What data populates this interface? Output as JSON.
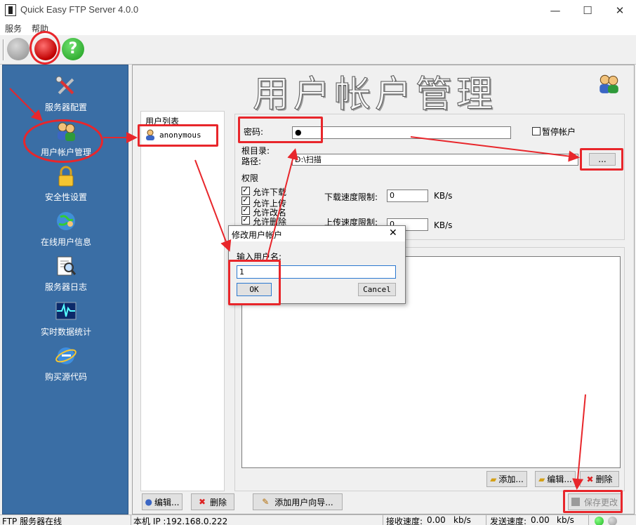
{
  "window": {
    "title": "Quick Easy FTP Server 4.0.0",
    "minimize": "—",
    "maximize": "☐",
    "close": "✕"
  },
  "menu": {
    "items": [
      "服务",
      "帮助"
    ]
  },
  "sidebar": {
    "items": [
      {
        "label": "服务器配置",
        "icon": "tools-icon"
      },
      {
        "label": "用户帐户管理",
        "icon": "users-icon"
      },
      {
        "label": "安全性设置",
        "icon": "lock-icon"
      },
      {
        "label": "在线用户信息",
        "icon": "globe-users-icon"
      },
      {
        "label": "服务器日志",
        "icon": "log-search-icon"
      },
      {
        "label": "实时数据统计",
        "icon": "pulse-chart-icon"
      },
      {
        "label": "购买源代码",
        "icon": "ie-globe-icon"
      }
    ]
  },
  "main": {
    "title": "用户帐户管理",
    "user_list": {
      "header": "用户列表",
      "users": [
        "anonymous"
      ]
    },
    "password_label": "密码:",
    "password_value": "●",
    "suspend_label": "暂停帐户",
    "root_dir_label": "根目录:",
    "path_label": "路径:",
    "path_value": "D:\\扫描",
    "browse_label": "...",
    "permissions_label": "权限",
    "permissions": [
      {
        "label": "允许下载",
        "checked": true
      },
      {
        "label": "允许上传",
        "checked": true
      },
      {
        "label": "允许改名",
        "checked": true
      },
      {
        "label": "允许删除",
        "checked": true
      }
    ],
    "download_limit_label": "下载速度限制:",
    "download_limit_value": "0",
    "upload_limit_label": "上传速度限制:",
    "upload_limit_value": "0",
    "speed_unit": "KB/s",
    "dir_add_label": "添加...",
    "dir_edit_label": "编辑...",
    "dir_delete_label": "删除",
    "user_edit_label": "编辑...",
    "user_delete_label": "删除",
    "user_wizard_label": "添加用户向导...",
    "save_label": "保存更改"
  },
  "dialog": {
    "title": "修改用户帐户",
    "prompt": "输入用户名:",
    "value": "1",
    "ok_label": "OK",
    "cancel_label": "Cancel",
    "close": "✕"
  },
  "statusbar": {
    "server_status": "FTP 服务器在线",
    "local_ip": "本机 IP :192.168.0.222",
    "receive_label": "接收速度:",
    "receive_value": "0.00",
    "send_label": "发送速度:",
    "send_value": "0.00",
    "unit": "kb/s"
  },
  "colors": {
    "sidebar_bg": "#3a6ea5",
    "annotation_red": "#e8262b",
    "led_green": "#22b822",
    "led_gray": "#9a9a9a"
  }
}
